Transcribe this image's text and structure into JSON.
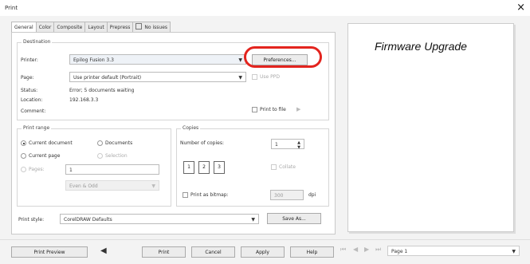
{
  "window": {
    "title": "Print",
    "close_symbol": "×"
  },
  "tabs": [
    {
      "label": "General"
    },
    {
      "label": "Color"
    },
    {
      "label": "Composite"
    },
    {
      "label": "Layout"
    },
    {
      "label": "Prepress"
    },
    {
      "label": "No issues"
    }
  ],
  "destination": {
    "title": "Destination",
    "printer_label": "Printer:",
    "printer_value": "Epilog Fusion 3.3",
    "preferences_button": "Preferences...",
    "page_label": "Page:",
    "page_value": "Use printer default (Portrait)",
    "use_ppd_label": "Use PPD",
    "status_label": "Status:",
    "status_value": "Error; 5 documents waiting",
    "location_label": "Location:",
    "location_value": "192.168.3.3",
    "comment_label": "Comment:",
    "print_to_file_label": "Print to file"
  },
  "print_range": {
    "title": "Print range",
    "current_document": "Current document",
    "documents": "Documents",
    "current_page": "Current page",
    "selection": "Selection",
    "pages_label": "Pages:",
    "pages_value": "1",
    "pages_dropdown": "Even & Odd"
  },
  "copies": {
    "title": "Copies",
    "number_label": "Number of copies:",
    "number_value": "1",
    "collate_label": "Collate",
    "tiles": [
      "1",
      "2",
      "3"
    ],
    "print_as_bitmap": "Print as bitmap:",
    "dpi_value": "300",
    "dpi_unit": "dpi"
  },
  "print_style": {
    "label": "Print style:",
    "value": "CorelDRAW Defaults",
    "save_as": "Save As..."
  },
  "buttons": {
    "print_preview": "Print Preview",
    "print": "Print",
    "cancel": "Cancel",
    "apply": "Apply",
    "help": "Help"
  },
  "preview": {
    "text": "Firmware Upgrade",
    "page_label": "Page 1"
  }
}
